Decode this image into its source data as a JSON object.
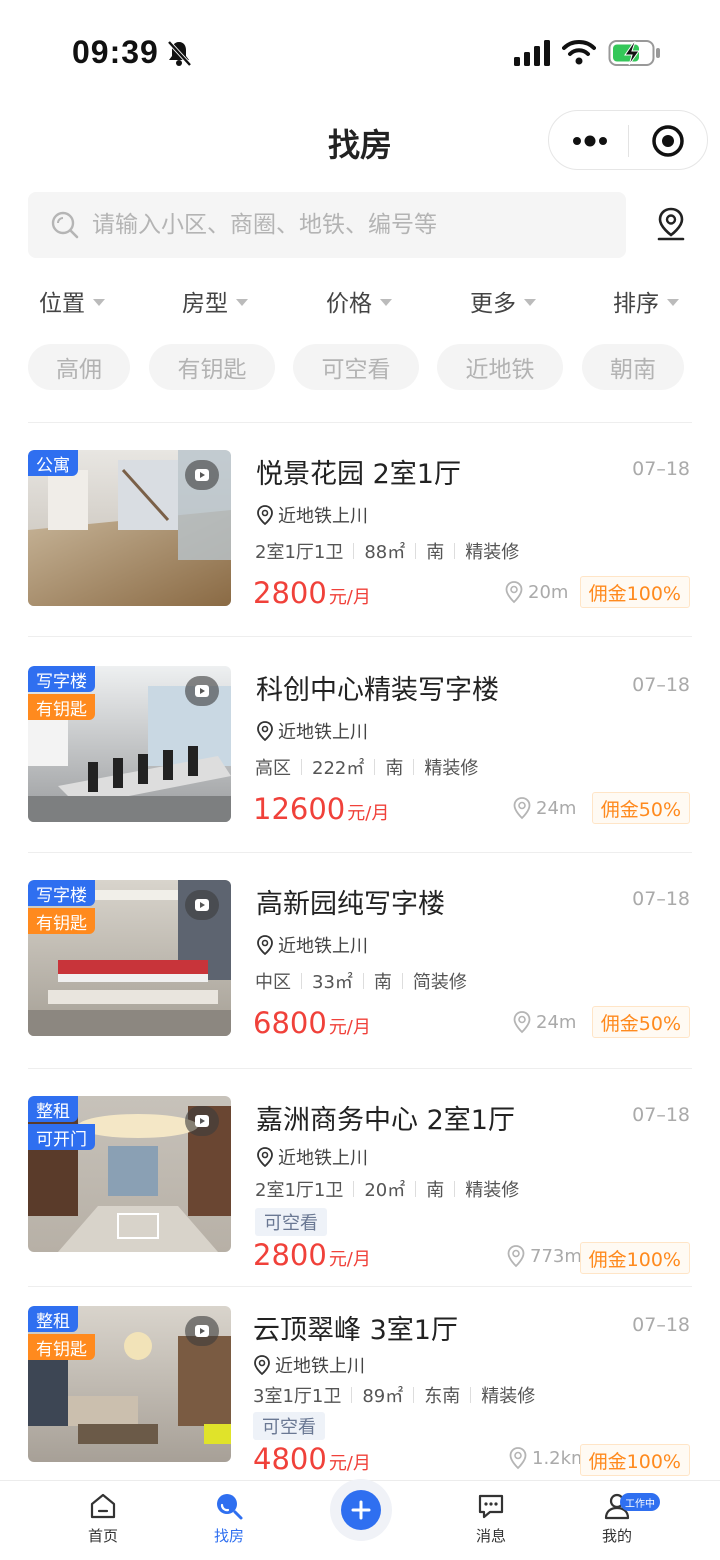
{
  "status_bar": {
    "time": "09:39"
  },
  "nav": {
    "title": "找房"
  },
  "search": {
    "placeholder": "请输入小区、商圈、地铁、编号等"
  },
  "filters": [
    "位置",
    "房型",
    "价格",
    "更多",
    "排序"
  ],
  "tags": [
    "高佣",
    "有钥匙",
    "可空看",
    "近地铁",
    "朝南"
  ],
  "listings": [
    {
      "badges": [
        "公寓"
      ],
      "title": "悦景花园 2室1厅",
      "date": "07–18",
      "location": "近地铁上川",
      "specs": [
        "2室1厅1卫",
        "88㎡",
        "南",
        "精装修"
      ],
      "price": "2800",
      "unit": "元/月",
      "distance": "20m",
      "commission": "佣金100%"
    },
    {
      "badges": [
        "写字楼",
        "有钥匙"
      ],
      "title": "科创中心精装写字楼",
      "date": "07–18",
      "location": "近地铁上川",
      "specs": [
        "高区",
        "222㎡",
        "南",
        "精装修"
      ],
      "price": "12600",
      "unit": "元/月",
      "distance": "24m",
      "commission": "佣金50%"
    },
    {
      "badges": [
        "写字楼",
        "有钥匙"
      ],
      "title": "高新园纯写字楼",
      "date": "07–18",
      "location": "近地铁上川",
      "specs": [
        "中区",
        "33㎡",
        "南",
        "简装修"
      ],
      "price": "6800",
      "unit": "元/月",
      "distance": "24m",
      "commission": "佣金50%"
    },
    {
      "badges": [
        "整租",
        "可开门"
      ],
      "title": "嘉洲商务中心 2室1厅",
      "date": "07–18",
      "location": "近地铁上川",
      "specs": [
        "2室1厅1卫",
        "20㎡",
        "南",
        "精装修"
      ],
      "chip": "可空看",
      "price": "2800",
      "unit": "元/月",
      "distance": "773m",
      "commission": "佣金100%"
    },
    {
      "badges": [
        "整租",
        "有钥匙"
      ],
      "title": "云顶翠峰 3室1厅",
      "date": "07–18",
      "location": "近地铁上川",
      "specs": [
        "3室1厅1卫",
        "89㎡",
        "东南",
        "精装修"
      ],
      "chip": "可空看",
      "price": "4800",
      "unit": "元/月",
      "distance": "1.2km",
      "commission": "佣金100%"
    }
  ],
  "tab_bar": {
    "items": [
      "首页",
      "找房",
      "消息",
      "我的"
    ],
    "work_badge": "工作中"
  },
  "colors": {
    "accent": "#2f6ff0",
    "price": "#f0413a",
    "commission": "#ff8a1e",
    "badge_orange": "#ff8a1e"
  }
}
